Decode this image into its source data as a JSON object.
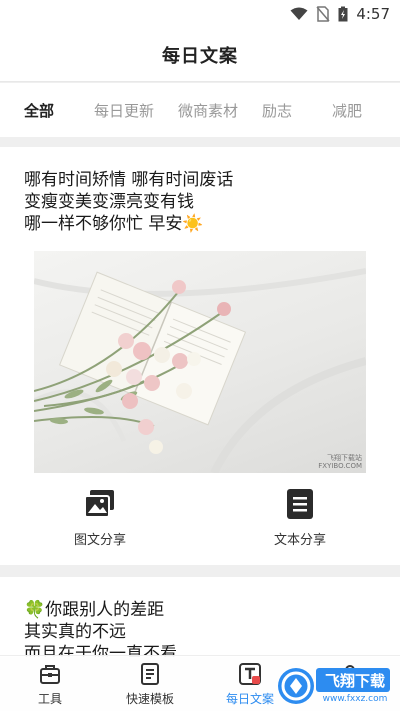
{
  "status_bar": {
    "time": "4:57"
  },
  "header": {
    "title": "每日文案"
  },
  "tabs": [
    {
      "label": "全部"
    },
    {
      "label": "每日更新"
    },
    {
      "label": "微商素材"
    },
    {
      "label": "励志"
    },
    {
      "label": "减肥"
    }
  ],
  "posts": [
    {
      "lines": [
        "哪有时间矫情 哪有时间废话",
        "变瘦变美变漂亮变有钱",
        "哪一样不够你忙 早安☀️"
      ],
      "image_watermark": [
        "飞翔下载站",
        "FXYIBO.COM"
      ],
      "actions": [
        {
          "label": "图文分享",
          "icon": "image-share-icon"
        },
        {
          "label": "文本分享",
          "icon": "text-share-icon"
        }
      ]
    },
    {
      "lines": [
        "🍀你跟别人的差距",
        "其实真的不远",
        "而且在于你一直不看"
      ]
    }
  ],
  "bottom_nav": [
    {
      "label": "工具",
      "icon": "toolbox-icon"
    },
    {
      "label": "快速模板",
      "icon": "template-icon"
    },
    {
      "label": "每日文案",
      "icon": "daily-copy-icon"
    },
    {
      "label": "",
      "icon": "profile-icon"
    }
  ],
  "watermark": {
    "text": "飞翔下载",
    "domain": "www.fxxz.com"
  },
  "colors": {
    "active": "#2d8cf0",
    "text": "#222222",
    "inactive_tab": "#999999",
    "background": "#efefef"
  }
}
